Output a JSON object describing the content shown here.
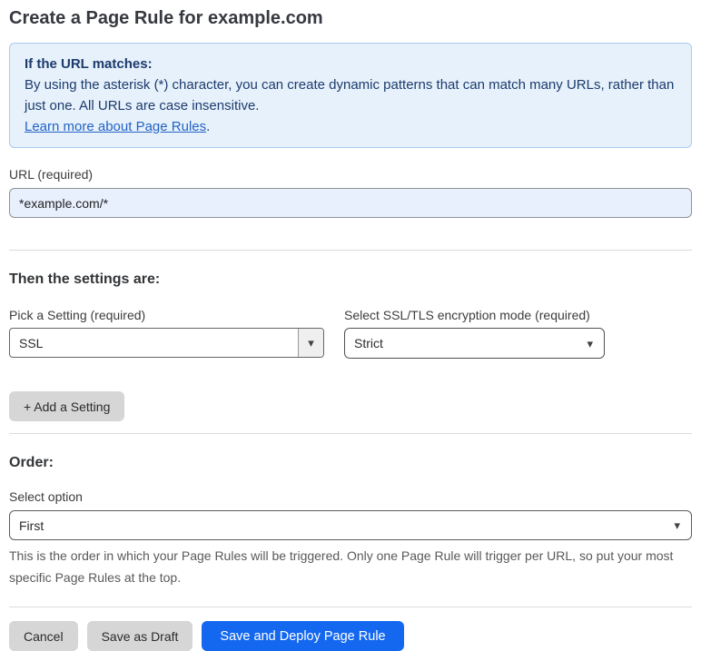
{
  "page": {
    "title": "Create a Page Rule for example.com"
  },
  "info_box": {
    "heading": "If the URL matches:",
    "body": "By using the asterisk (*) character, you can create dynamic patterns that can match many URLs, rather than just one. All URLs are case insensitive.",
    "link_label": "Learn more about Page Rules",
    "link_suffix": "."
  },
  "url_field": {
    "label": "URL (required)",
    "value": "*example.com/*"
  },
  "settings_section": {
    "heading": "Then the settings are:",
    "setting_select": {
      "label": "Pick a Setting (required)",
      "value": "SSL"
    },
    "mode_select": {
      "label": "Select SSL/TLS encryption mode (required)",
      "value": "Strict"
    },
    "add_setting_label": "+ Add a Setting"
  },
  "order_section": {
    "heading": "Order:",
    "select_label": "Select option",
    "select_value": "First",
    "help_text": "This is the order in which your Page Rules will be triggered. Only one Page Rule will trigger per URL, so put your most specific Page Rules at the top."
  },
  "footer": {
    "cancel_label": "Cancel",
    "save_draft_label": "Save as Draft",
    "save_deploy_label": "Save and Deploy Page Rule"
  },
  "icons": {
    "chevron_down": "▾"
  },
  "colors": {
    "accent_blue": "#1468f0",
    "info_bg": "#e6f1fb",
    "info_border": "#aacbee",
    "info_text": "#1d3b6d",
    "link": "#2563c4",
    "input_bg": "#e8f0fe"
  }
}
